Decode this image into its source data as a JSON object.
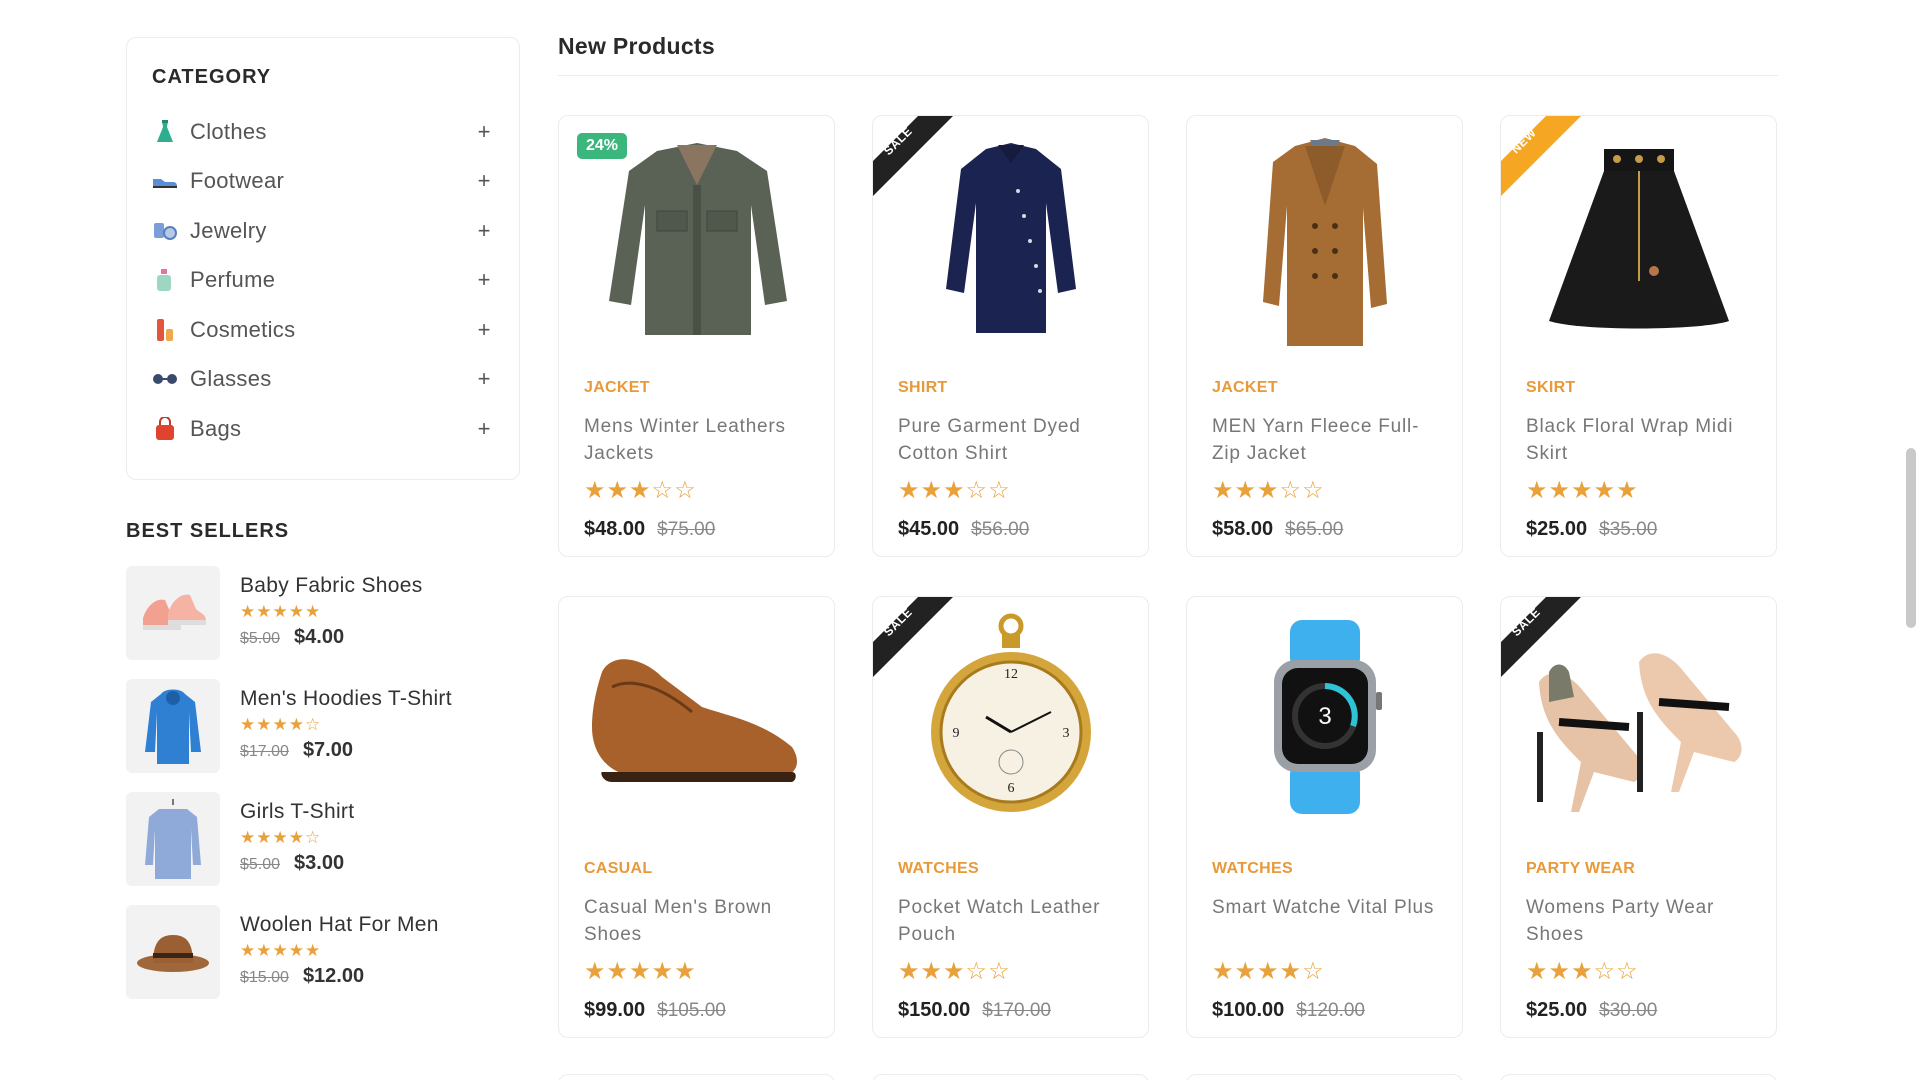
{
  "sidebar": {
    "category_title": "CATEGORY",
    "categories": [
      {
        "label": "Clothes",
        "icon": "dress-icon"
      },
      {
        "label": "Footwear",
        "icon": "shoe-icon"
      },
      {
        "label": "Jewelry",
        "icon": "jewelry-icon"
      },
      {
        "label": "Perfume",
        "icon": "perfume-icon"
      },
      {
        "label": "Cosmetics",
        "icon": "cosmetics-icon"
      },
      {
        "label": "Glasses",
        "icon": "glasses-icon"
      },
      {
        "label": "Bags",
        "icon": "bag-icon"
      }
    ],
    "expand_symbol": "+",
    "best_sellers_title": "BEST SELLERS",
    "best_sellers": [
      {
        "name": "Baby Fabric Shoes",
        "stars": "★★★★★",
        "old_price": "$5.00",
        "price": "$4.00"
      },
      {
        "name": "Men's Hoodies T-Shirt",
        "stars": "★★★★☆",
        "old_price": "$17.00",
        "price": "$7.00"
      },
      {
        "name": "Girls T-Shirt",
        "stars": "★★★★☆",
        "old_price": "$5.00",
        "price": "$3.00"
      },
      {
        "name": "Woolen Hat For Men",
        "stars": "★★★★★",
        "old_price": "$15.00",
        "price": "$12.00"
      }
    ]
  },
  "main": {
    "title": "New Products",
    "products": [
      {
        "category": "JACKET",
        "name": "Mens Winter Leathers Jackets",
        "stars": "★★★☆☆",
        "price": "$48.00",
        "old_price": "$75.00",
        "badge": "24%"
      },
      {
        "category": "SHIRT",
        "name": "Pure Garment Dyed Cotton Shirt",
        "stars": "★★★☆☆",
        "price": "$45.00",
        "old_price": "$56.00",
        "badge": "SALE"
      },
      {
        "category": "JACKET",
        "name": "MEN Yarn Fleece Full-Zip Jacket",
        "stars": "★★★☆☆",
        "price": "$58.00",
        "old_price": "$65.00",
        "badge": ""
      },
      {
        "category": "SKIRT",
        "name": "Black Floral Wrap Midi Skirt",
        "stars": "★★★★★",
        "price": "$25.00",
        "old_price": "$35.00",
        "badge": "NEW"
      },
      {
        "category": "CASUAL",
        "name": "Casual Men's Brown Shoes",
        "stars": "★★★★★",
        "price": "$99.00",
        "old_price": "$105.00",
        "badge": ""
      },
      {
        "category": "WATCHES",
        "name": "Pocket Watch Leather Pouch",
        "stars": "★★★☆☆",
        "price": "$150.00",
        "old_price": "$170.00",
        "badge": "SALE"
      },
      {
        "category": "WATCHES",
        "name": "Smart Watche Vital Plus",
        "stars": "★★★★☆",
        "price": "$100.00",
        "old_price": "$120.00",
        "badge": ""
      },
      {
        "category": "PARTY WEAR",
        "name": "Womens Party Wear Shoes",
        "stars": "★★★☆☆",
        "price": "$25.00",
        "old_price": "$30.00",
        "badge": "SALE"
      }
    ],
    "watch_face_number": "3"
  },
  "colors": {
    "accent": "#e8993a",
    "badge_green": "#3bb77e",
    "ribbon_black": "#222222",
    "ribbon_orange": "#f5a623",
    "stars": "#e9a13b"
  }
}
